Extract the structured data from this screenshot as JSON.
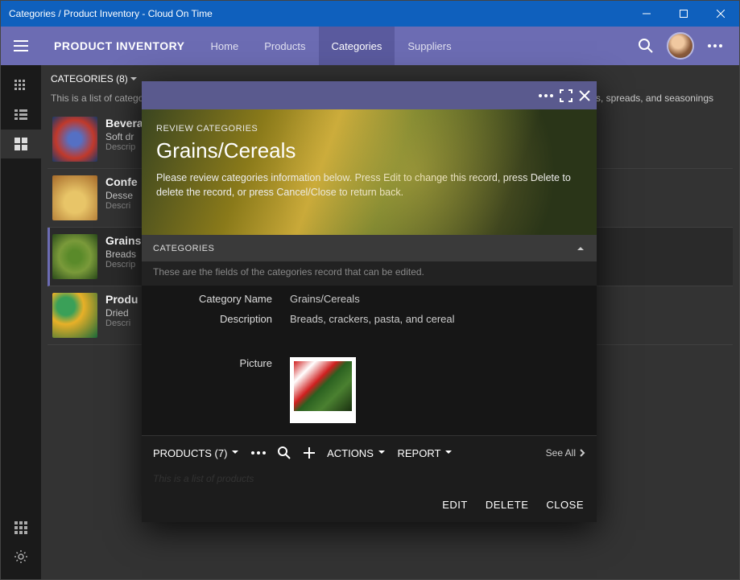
{
  "window": {
    "title": "Categories / Product Inventory - Cloud On Time"
  },
  "appbar": {
    "title": "PRODUCT INVENTORY",
    "tabs": [
      {
        "label": "Home",
        "active": false
      },
      {
        "label": "Products",
        "active": false
      },
      {
        "label": "Categories",
        "active": true
      },
      {
        "label": "Suppliers",
        "active": false
      }
    ]
  },
  "section": {
    "header": "CATEGORIES (8)",
    "description_intro": "This is a list of catego",
    "description_trailing": "s, spreads, and seasonings"
  },
  "list": [
    {
      "title": "Bevera",
      "desc": "Soft dr",
      "meta": "Descrip"
    },
    {
      "title": "Confe",
      "desc": "Desse",
      "meta": "Descri"
    },
    {
      "title": "Grains",
      "desc": "Breads",
      "meta": "Descrip"
    },
    {
      "title": "Produ",
      "desc": "Dried",
      "meta": "Descri"
    }
  ],
  "modal": {
    "breadcrumb": "REVIEW CATEGORIES",
    "title": "Grains/Cereals",
    "instructions": "Please review categories information below. Press Edit to change this record, press Delete to delete the record, or press Cancel/Close to return back.",
    "section_header": "CATEGORIES",
    "section_sub": "These are the fields of the categories record that can be edited.",
    "fields": {
      "category_name": {
        "label": "Category Name",
        "value": "Grains/Cereals"
      },
      "description": {
        "label": "Description",
        "value": "Breads, crackers, pasta, and cereal"
      },
      "picture": {
        "label": "Picture"
      }
    },
    "toolbar": {
      "products_label": "PRODUCTS (7)",
      "actions_label": "ACTIONS",
      "report_label": "REPORT",
      "see_all": "See All"
    },
    "loading": "This is a list of products",
    "actions": {
      "edit": "EDIT",
      "delete": "DELETE",
      "close": "CLOSE"
    }
  }
}
